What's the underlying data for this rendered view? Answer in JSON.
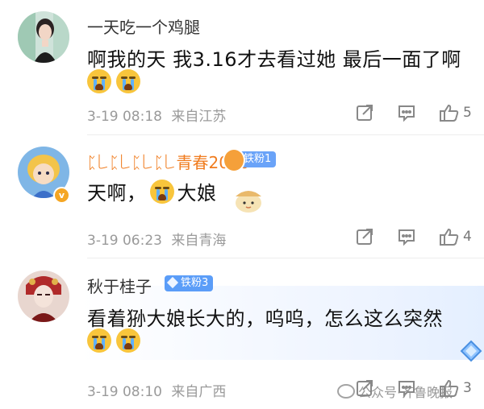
{
  "comments": [
    {
      "username": "一天吃一个鸡腿",
      "text": "啊我的天 我3.16才去看过她 最后一面了啊",
      "emoji_icons": [
        "crying-face-icon",
        "crying-face-icon"
      ],
      "timestamp": "3-19 08:18",
      "location": "来自江苏",
      "likes": "5"
    },
    {
      "username": "ᛈ꒒ᛈ꒒ᛈ꒒ᛈ꒒青春2010",
      "fan_badge": "铁粉1",
      "verified_badge": "v",
      "text_parts": [
        "天啊，",
        "大娘"
      ],
      "emoji_icons": [
        "crying-face-icon"
      ],
      "timestamp": "3-19 06:23",
      "location": "来自青海",
      "likes": "4"
    },
    {
      "username": "秋于桂子",
      "fan_badge": "铁粉3",
      "text": "看着狲大娘长大的，呜呜，怎么这么突然",
      "emoji_icons": [
        "crying-face-icon",
        "crying-face-icon"
      ],
      "timestamp": "3-19 08:10",
      "location": "来自广西",
      "likes": "3"
    }
  ],
  "watermark": "公众号·齐鲁晚报",
  "colors": {
    "vip_name": "#f07c1f",
    "fan_badge": "#5b9df8",
    "meta_text": "#9a9a9a",
    "highlight_bg": "#e4efff"
  }
}
